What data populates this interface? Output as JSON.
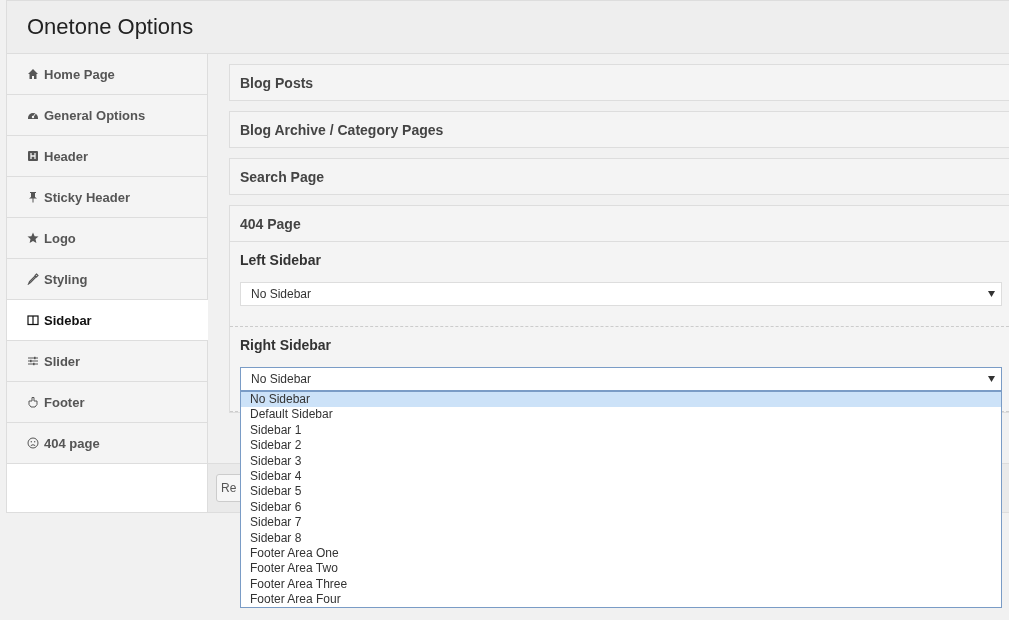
{
  "window": {
    "title": "Onetone Options"
  },
  "nav": [
    {
      "label": "Home Page",
      "selected": false
    },
    {
      "label": "General Options",
      "selected": false
    },
    {
      "label": "Header",
      "selected": false
    },
    {
      "label": "Sticky Header",
      "selected": false
    },
    {
      "label": "Logo",
      "selected": false
    },
    {
      "label": "Styling",
      "selected": false
    },
    {
      "label": "Sidebar",
      "selected": true
    },
    {
      "label": "Slider",
      "selected": false
    },
    {
      "label": "Footer",
      "selected": false
    },
    {
      "label": "404 page",
      "selected": false
    }
  ],
  "sections": [
    {
      "title": "Blog Posts",
      "expanded": false
    },
    {
      "title": "Blog Archive / Category Pages",
      "expanded": false
    },
    {
      "title": "Search Page",
      "expanded": false
    },
    {
      "title": "404 Page",
      "expanded": true,
      "fields": [
        {
          "label": "Left Sidebar",
          "value": "No Sidebar",
          "open": false
        },
        {
          "label": "Right Sidebar",
          "value": "No Sidebar",
          "open": true,
          "options": [
            {
              "label": "No Sidebar",
              "selected": true
            },
            {
              "label": "Default Sidebar",
              "selected": false
            },
            {
              "label": "Sidebar 1",
              "selected": false
            },
            {
              "label": "Sidebar 2",
              "selected": false
            },
            {
              "label": "Sidebar 3",
              "selected": false
            },
            {
              "label": "Sidebar 4",
              "selected": false
            },
            {
              "label": "Sidebar 5",
              "selected": false
            },
            {
              "label": "Sidebar 6",
              "selected": false
            },
            {
              "label": "Sidebar 7",
              "selected": false
            },
            {
              "label": "Sidebar 8",
              "selected": false
            },
            {
              "label": "Footer Area One",
              "selected": false
            },
            {
              "label": "Footer Area Two",
              "selected": false
            },
            {
              "label": "Footer Area Three",
              "selected": false
            },
            {
              "label": "Footer Area Four",
              "selected": false
            }
          ]
        }
      ]
    }
  ],
  "footer": {
    "button": "Re"
  }
}
